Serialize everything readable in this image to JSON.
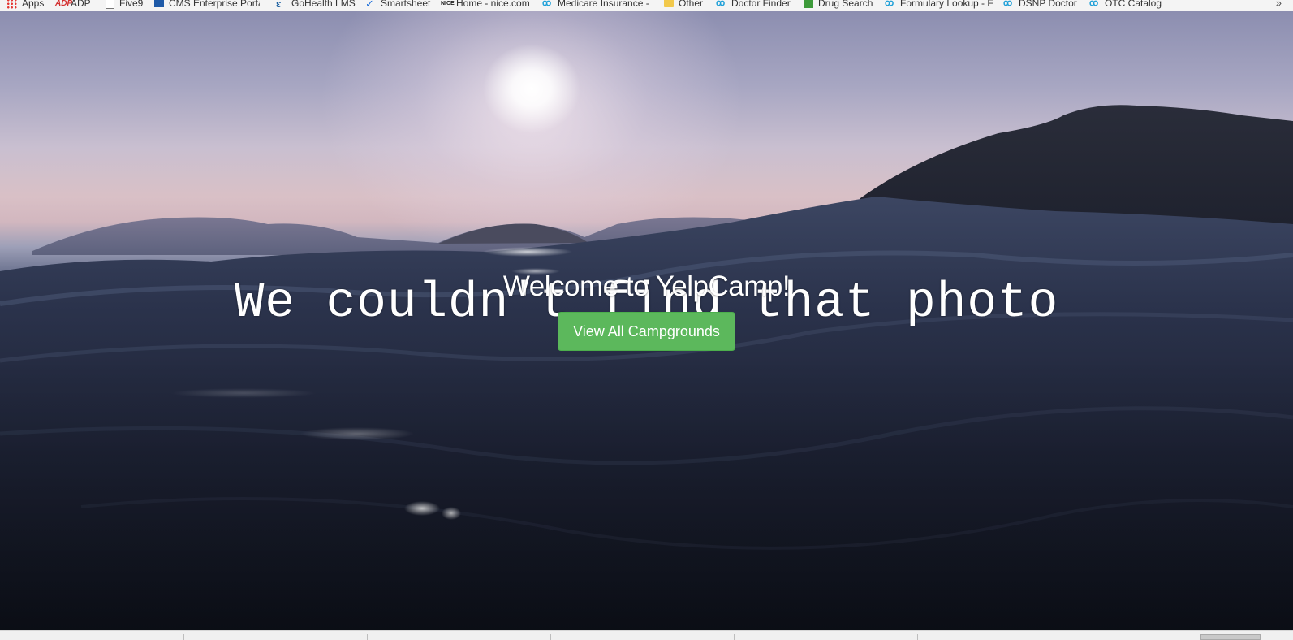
{
  "bookmarks_bar": {
    "items": [
      {
        "label": "Apps",
        "icon": "apps-grid-icon"
      },
      {
        "label": "ADP",
        "icon": "adp-logo-icon"
      },
      {
        "label": "Five9",
        "icon": "page-icon"
      },
      {
        "label": "CMS Enterprise Portal",
        "icon": "cms-logo-icon"
      },
      {
        "label": "GoHealth LMS",
        "icon": "gohealth-logo-icon"
      },
      {
        "label": "Smartsheet",
        "icon": "smartsheet-check-icon"
      },
      {
        "label": "Home - nice.com",
        "icon": "nice-logo-icon"
      },
      {
        "label": "Medicare Insurance -",
        "icon": "humana-logo-icon"
      },
      {
        "label": "Other",
        "icon": "folder-icon"
      },
      {
        "label": "Doctor Finder",
        "icon": "humana-logo-icon"
      },
      {
        "label": "Drug Search",
        "icon": "drug-search-icon"
      },
      {
        "label": "Formulary Lookup - F",
        "icon": "humana-logo-icon"
      },
      {
        "label": "DSNP Doctor",
        "icon": "humana-logo-icon"
      },
      {
        "label": "OTC Catalog",
        "icon": "humana-logo-icon"
      }
    ],
    "overflow": "»"
  },
  "hero": {
    "broken_image_alt": "We couldn't find that photo"
  },
  "landing": {
    "title": "Welcome to YelpCamp!",
    "button_label": "View All Campgrounds"
  },
  "colors": {
    "button_green": "#5cb85c",
    "button_border": "#4cae4c",
    "text_white": "#ffffff"
  }
}
